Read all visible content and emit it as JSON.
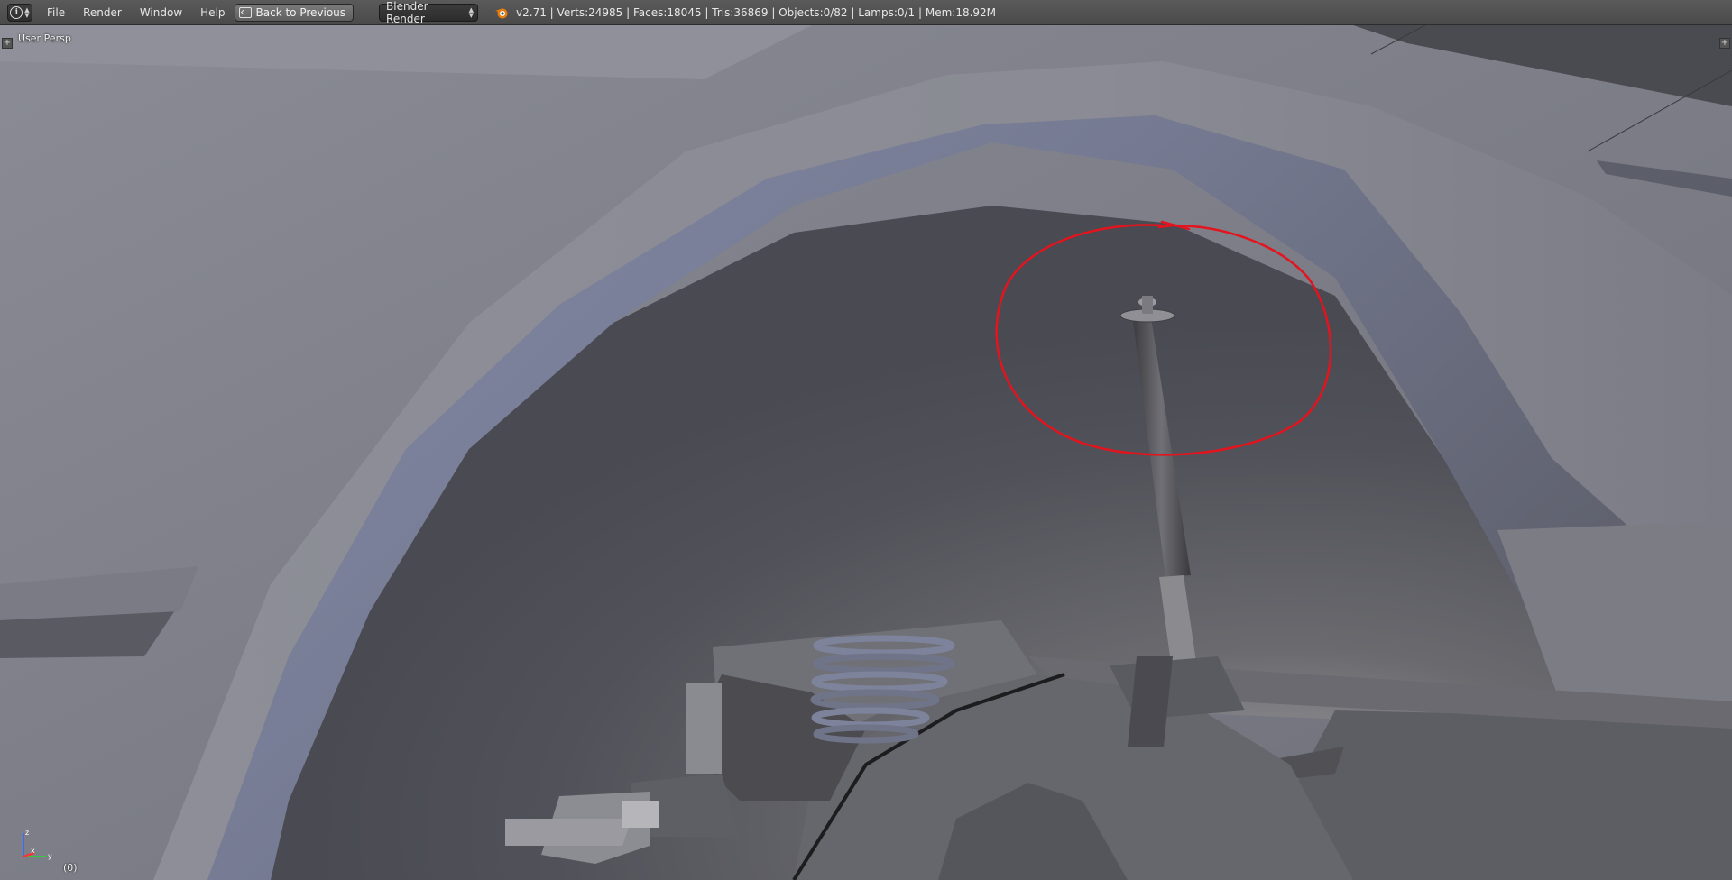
{
  "header": {
    "editor_type_icon": "info-icon",
    "menus": [
      "File",
      "Render",
      "Window",
      "Help"
    ],
    "back_button_label": "Back to Previous",
    "render_engine": "Blender Render",
    "stats": "v2.71 | Verts:24985 | Faces:18045 | Tris:36869 | Objects:0/82 | Lamps:0/1 | Mem:18.92M"
  },
  "viewport": {
    "view_label": "User Persp",
    "frame_label": "(0)",
    "axis_labels": {
      "z": "z",
      "x": "x",
      "y": "y"
    },
    "annotation_color": "#e3141e"
  },
  "colors": {
    "header_bg": "#4a4a4a",
    "mesh_light": "#8e8f98",
    "mesh_blue": "#7f86a4",
    "mesh_dark": "#4f5058"
  }
}
